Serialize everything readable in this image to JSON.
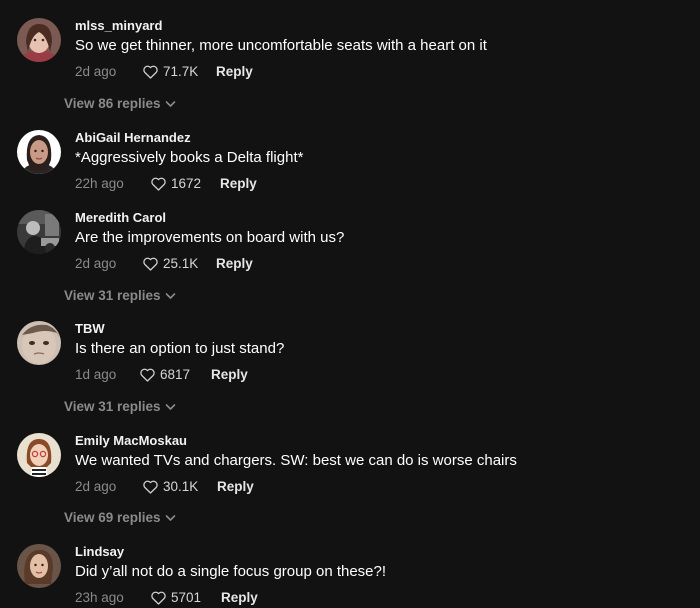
{
  "comments": [
    {
      "username": "mlss_minyard",
      "text": "So we get thinner, more uncomfortable seats with a heart on it",
      "time": "2d ago",
      "likes": "71.7K",
      "reply_label": "Reply",
      "view_replies": "View 86 replies"
    },
    {
      "username": "AbiGail Hernandez",
      "text": "*Aggressively books a Delta flight*",
      "time": "22h ago",
      "likes": "1672",
      "reply_label": "Reply"
    },
    {
      "username": "Meredith Carol",
      "text": "Are the improvements on board with us?",
      "time": "2d ago",
      "likes": "25.1K",
      "reply_label": "Reply",
      "view_replies": "View 31 replies"
    },
    {
      "username": "TBW",
      "text": "Is there an option to just stand?",
      "time": "1d ago",
      "likes": "6817",
      "reply_label": "Reply",
      "view_replies": "View 31 replies"
    },
    {
      "username": "Emily MacMoskau",
      "text": "We wanted TVs and chargers. SW: best we can do is worse chairs",
      "time": "2d ago",
      "likes": "30.1K",
      "reply_label": "Reply",
      "view_replies": "View 69 replies"
    },
    {
      "username": "Lindsay",
      "text": "Did y’all not do a single focus group on these?!",
      "time": "23h ago",
      "likes": "5701",
      "reply_label": "Reply"
    }
  ],
  "colors": {
    "background": "#121212",
    "primary_text": "#ffffff",
    "secondary_text": "#8a8a8a"
  },
  "icons": {
    "like": "heart-outline-icon",
    "expand": "chevron-down-icon"
  }
}
